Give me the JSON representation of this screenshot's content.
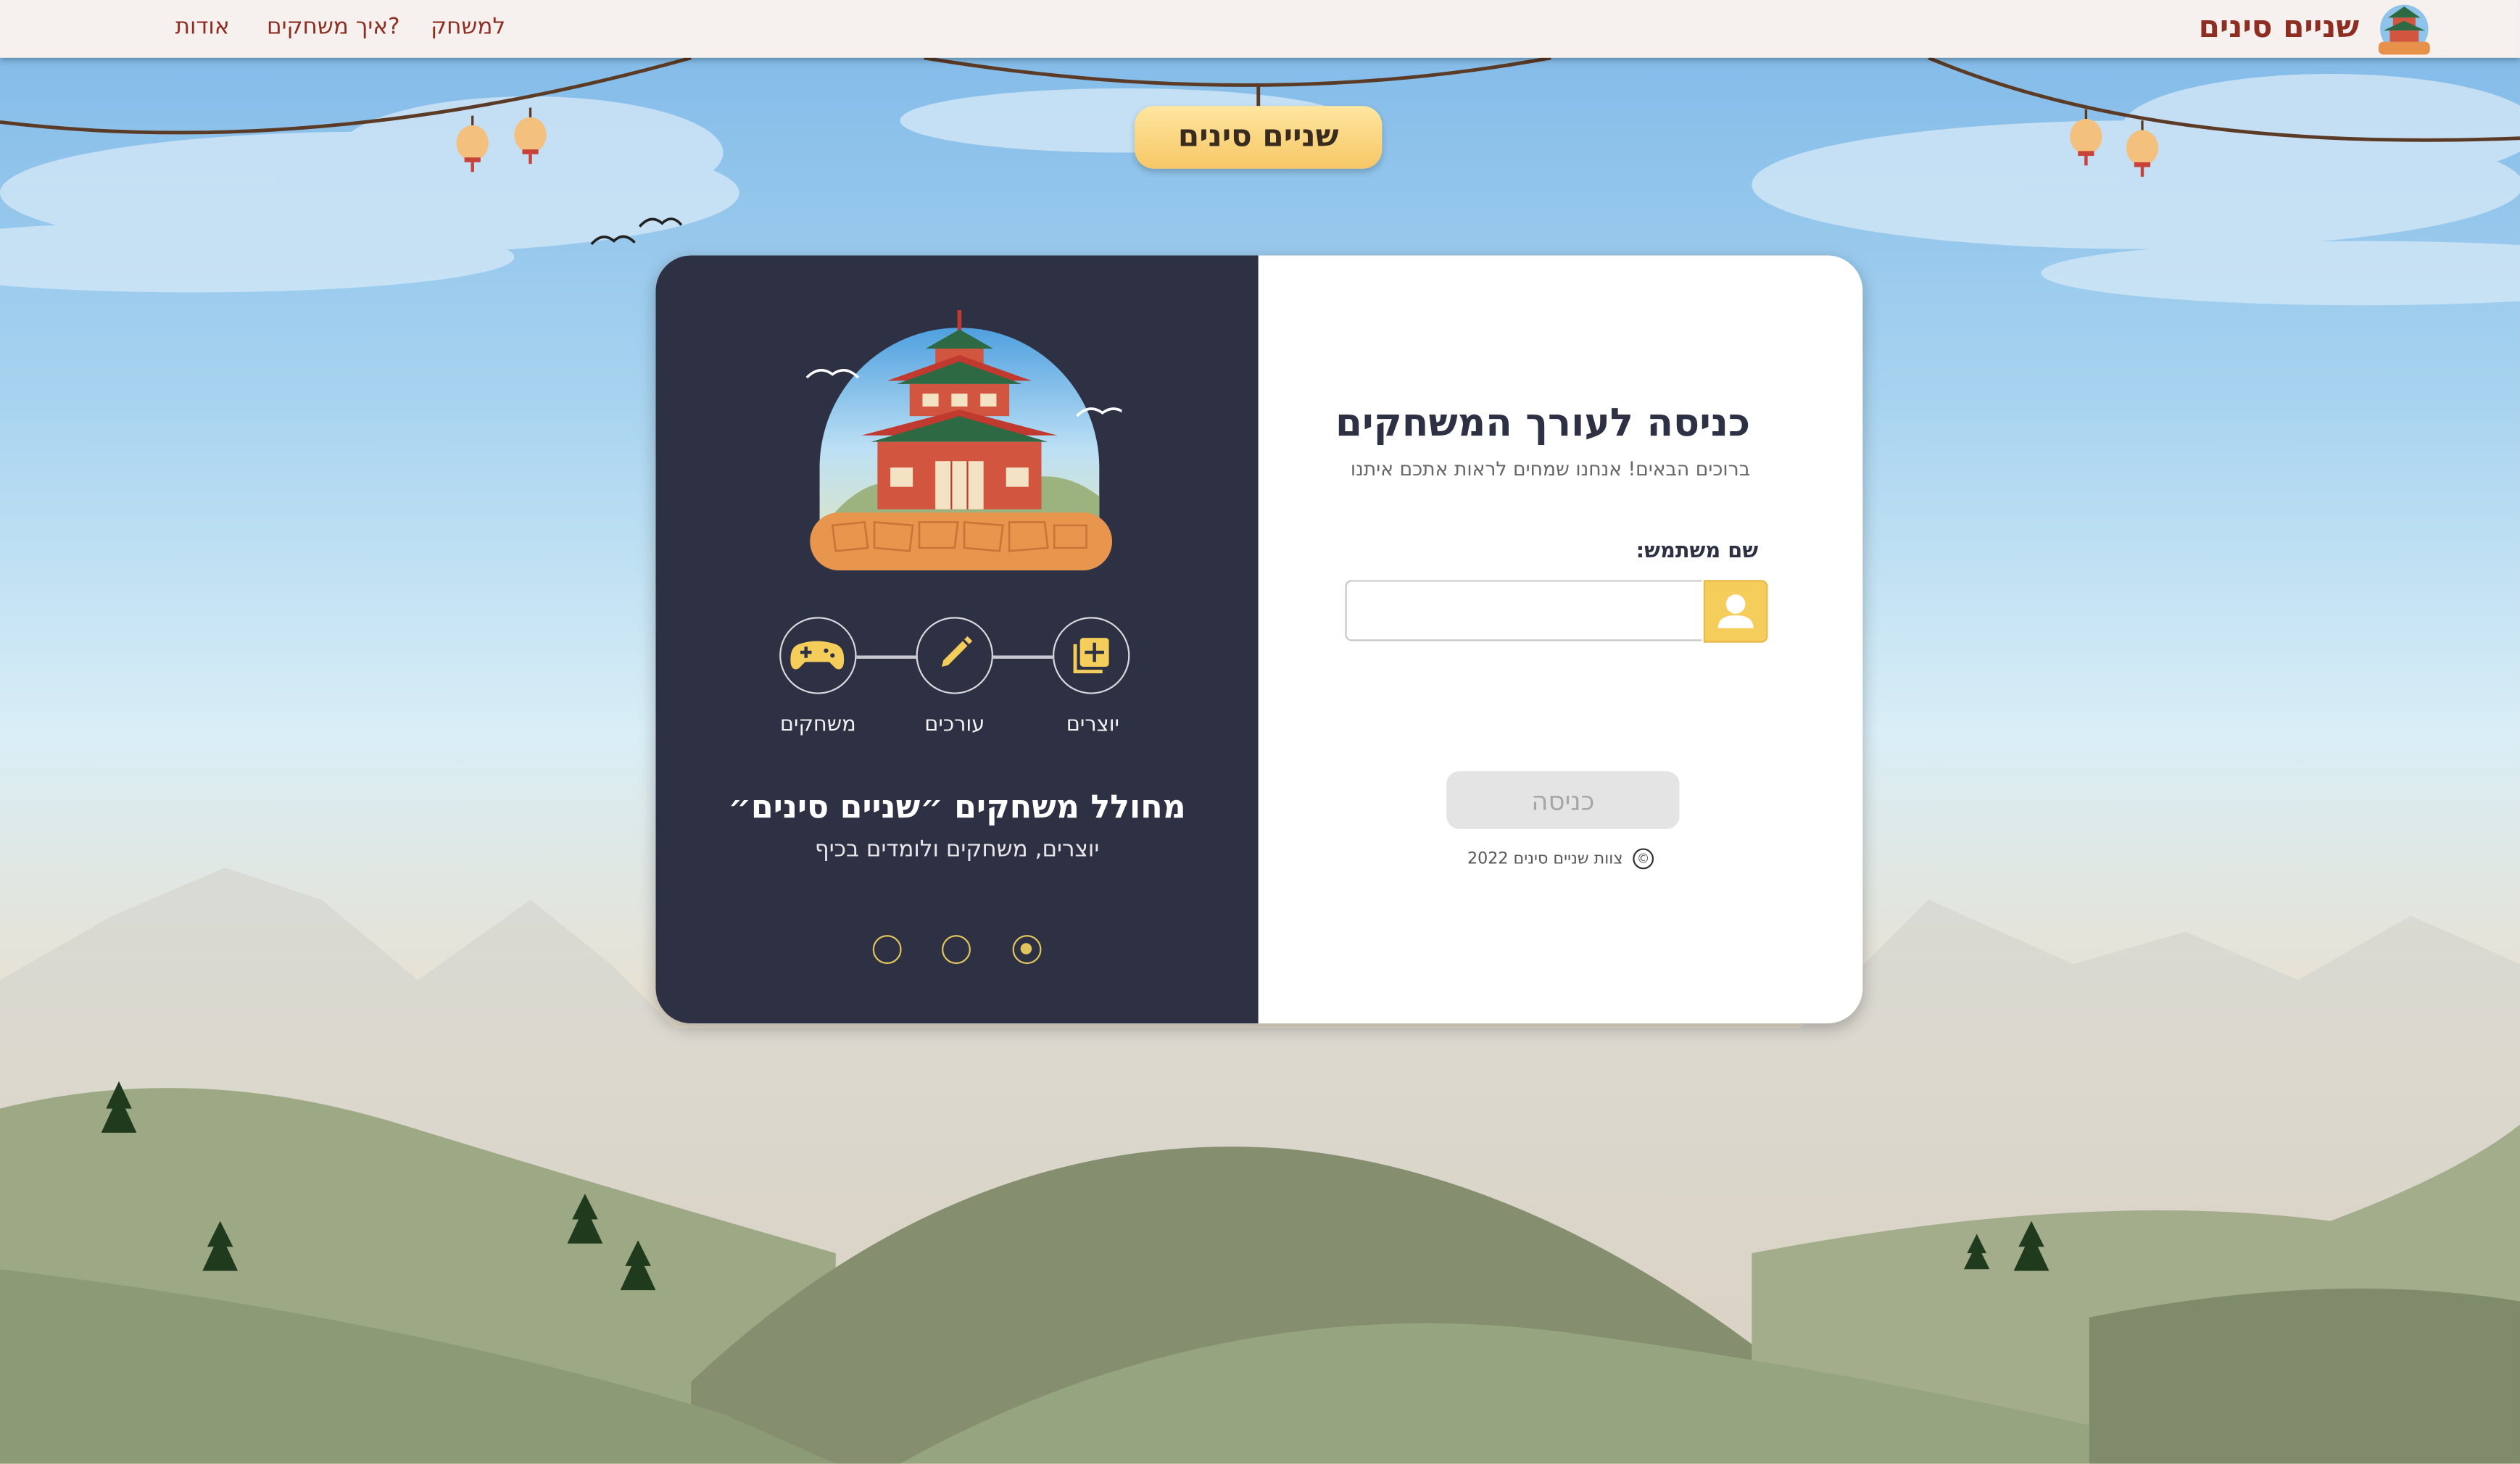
{
  "nav": {
    "brand": "שניים סינים",
    "links": [
      "אודות",
      "איך משחקים?",
      "למשחק"
    ]
  },
  "badge": {
    "label": "שניים סינים"
  },
  "left_panel": {
    "steps": [
      {
        "label": "יוצרים",
        "icon": "add-cards-icon"
      },
      {
        "label": "עורכים",
        "icon": "pencil-icon"
      },
      {
        "label": "משחקים",
        "icon": "gamepad-icon"
      }
    ],
    "title": "מחולל משחקים ״שניים סינים״",
    "subtitle": "יוצרים, משחקים ולומדים בכיף",
    "carousel": {
      "total": 3,
      "active_index": 1
    }
  },
  "login": {
    "title": "כניסה לעורך המשחקים",
    "subtitle": "ברוכים הבאים! אנחנו שמחים לראות אתכם איתנו",
    "username_label": "שם משתמש:",
    "username_value": "",
    "username_placeholder": "",
    "submit_label": "כניסה",
    "copyright_text": "צוות שניים סינים 2022",
    "copyright_symbol": "©"
  },
  "colors": {
    "brand_red": "#8e2d22",
    "panel_dark": "#2e3143",
    "accent_yellow": "#f5cd5b"
  }
}
